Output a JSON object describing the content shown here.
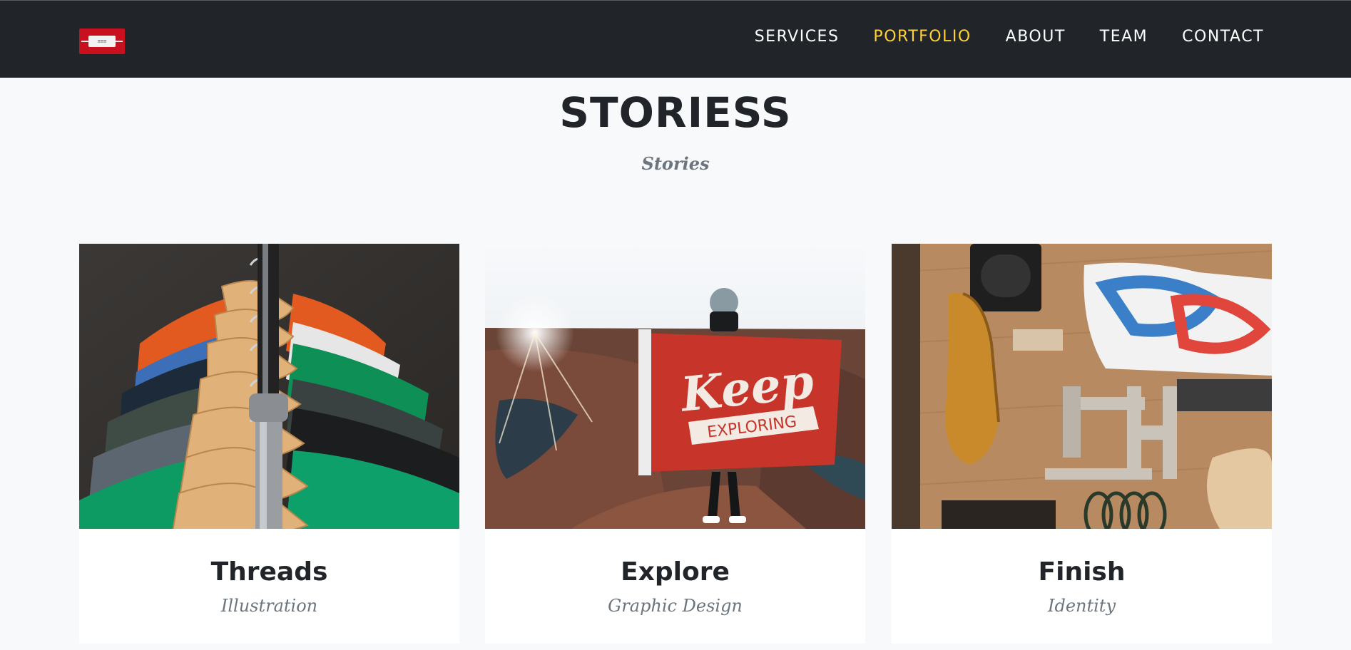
{
  "nav": {
    "items": [
      {
        "label": "SERVICES"
      },
      {
        "label": "PORTFOLIO",
        "active": true
      },
      {
        "label": "ABOUT"
      },
      {
        "label": "TEAM"
      },
      {
        "label": "CONTACT"
      }
    ]
  },
  "section": {
    "heading": "STORIESS",
    "subheading": "Stories"
  },
  "portfolio": {
    "items": [
      {
        "title": "Threads",
        "category": "Illustration"
      },
      {
        "title": "Explore",
        "category": "Graphic Design"
      },
      {
        "title": "Finish",
        "category": "Identity"
      }
    ]
  },
  "colors": {
    "navbar": "#212529",
    "accent": "#fed136",
    "background": "#f8f9fa",
    "logo": "#c8101e"
  }
}
